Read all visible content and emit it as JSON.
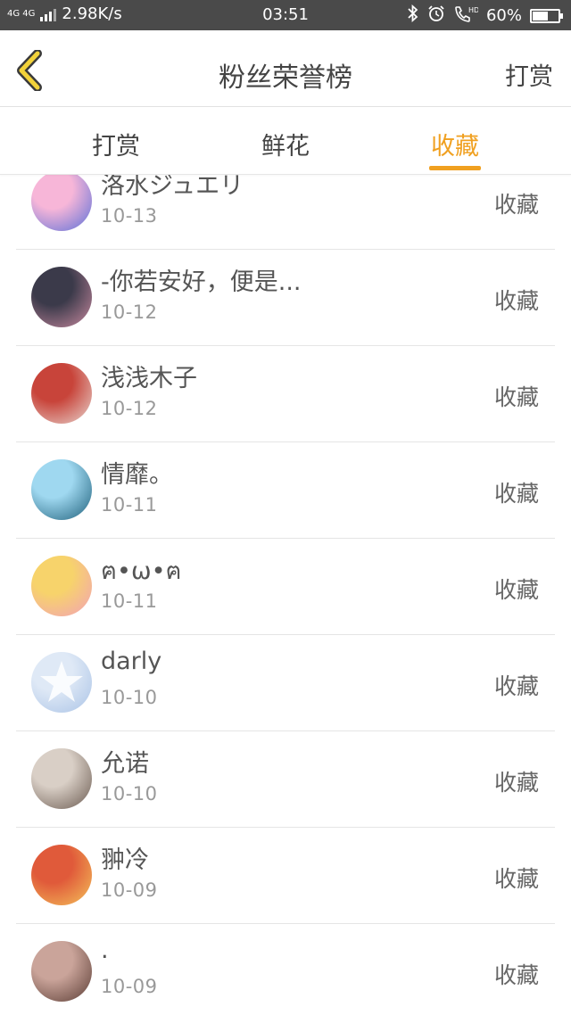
{
  "status_bar": {
    "network": "4G 4G",
    "speed": "2.98K/s",
    "time": "03:51",
    "battery": "60%",
    "battery_level": 0.6,
    "icons": [
      "signal-icon",
      "bluetooth-icon",
      "alarm-icon",
      "hd-call-icon",
      "battery-icon"
    ]
  },
  "header": {
    "back_icon": "chevron-left-icon",
    "title": "粉丝荣誉榜",
    "action": "打赏"
  },
  "tabs": {
    "items": [
      {
        "label": "打赏"
      },
      {
        "label": "鲜花"
      },
      {
        "label": "收藏"
      }
    ],
    "active_index": 2,
    "active_color": "#f0a020"
  },
  "list": {
    "items": [
      {
        "name": "洛水ジュエリ",
        "date": "10-13",
        "action": "收藏",
        "avatar_colors": [
          "#f7b6d8",
          "#5a6fd8"
        ]
      },
      {
        "name": "-你若安好，便是...",
        "date": "10-12",
        "action": "收藏",
        "avatar_colors": [
          "#3b3a4a",
          "#c98aa0"
        ]
      },
      {
        "name": "浅浅木子",
        "date": "10-12",
        "action": "收藏",
        "avatar_colors": [
          "#c8443a",
          "#e8d6d0"
        ]
      },
      {
        "name": "情靡。",
        "date": "10-11",
        "action": "收藏",
        "avatar_colors": [
          "#9fd8f0",
          "#1e5f7a"
        ]
      },
      {
        "name": "ฅ•ω•ฅ",
        "date": "10-11",
        "action": "收藏",
        "avatar_colors": [
          "#f7d36b",
          "#f2a1b8"
        ]
      },
      {
        "name": "darly",
        "date": "10-10",
        "action": "收藏",
        "avatar_colors": [
          "#dfe9f6",
          "#aac3e6"
        ]
      },
      {
        "name": "允诺",
        "date": "10-10",
        "action": "收藏",
        "avatar_colors": [
          "#d9cfc6",
          "#6a5a50"
        ]
      },
      {
        "name": "翀冷",
        "date": "10-09",
        "action": "收藏",
        "avatar_colors": [
          "#e05a3a",
          "#f4c25a"
        ]
      },
      {
        "name": ".",
        "date": "10-09",
        "action": "收藏",
        "avatar_colors": [
          "#caa49a",
          "#5a3c34"
        ]
      }
    ]
  }
}
